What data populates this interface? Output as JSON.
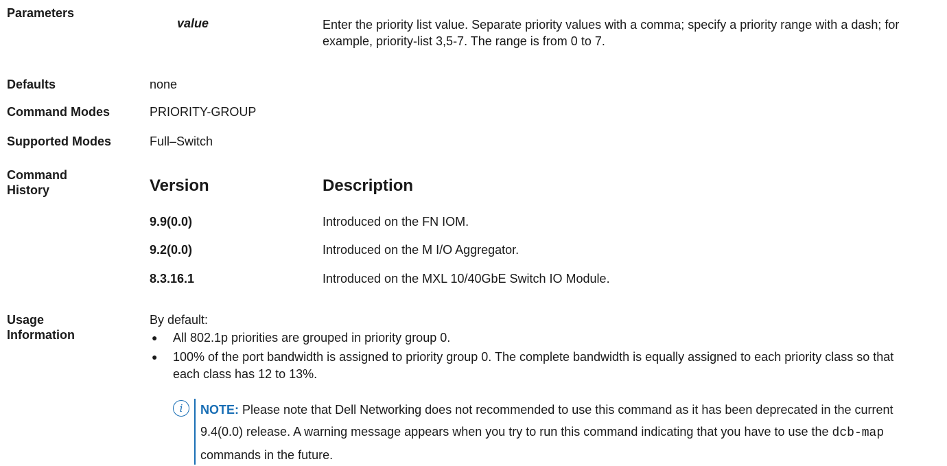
{
  "parameters": {
    "label": "Parameters",
    "name": "value",
    "description": "Enter the priority list value. Separate priority values with a comma; specify a priority range with a dash; for example, priority-list 3,5-7. The range is from 0 to 7."
  },
  "defaults": {
    "label": "Defaults",
    "value": "none"
  },
  "command_modes": {
    "label": "Command Modes",
    "value": "PRIORITY-GROUP"
  },
  "supported_modes": {
    "label": "Supported Modes",
    "value": "Full–Switch"
  },
  "command_history": {
    "label_line1": "Command",
    "label_line2": "History",
    "col_version": "Version",
    "col_description": "Description",
    "rows": [
      {
        "version": "9.9(0.0)",
        "description": "Introduced on the FN IOM."
      },
      {
        "version": "9.2(0.0)",
        "description": "Introduced on the M I/O Aggregator."
      },
      {
        "version": "8.3.16.1",
        "description": "Introduced on the MXL 10/40GbE Switch IO Module."
      }
    ]
  },
  "usage": {
    "label_line1": "Usage",
    "label_line2": "Information",
    "intro": "By default:",
    "bullets": [
      "All 802.1p priorities are grouped in priority group 0.",
      "100% of the port bandwidth is assigned to priority group 0. The complete bandwidth is equally assigned to each priority class so that each class has 12 to 13%."
    ],
    "note": {
      "label": "NOTE:",
      "text_before": "Please note that Dell Networking does not recommended to use this command as it has been deprecated in the current 9.4(0.0) release. A warning message appears when you try to run this command indicating that you have to use the",
      "code": "dcb-map",
      "text_after": "commands in the future."
    }
  },
  "colors": {
    "note_accent": "#1a6fb5"
  },
  "icons": {
    "note": "info-icon"
  }
}
